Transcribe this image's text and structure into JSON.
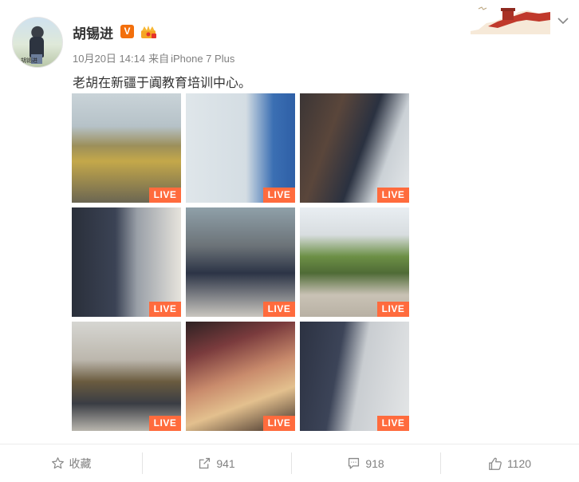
{
  "post": {
    "username": "胡锡进",
    "verified_badge": "V",
    "avatar_caption": "胡锡进",
    "date": "10月20日 14:14",
    "source_prefix": "来自",
    "source": "iPhone 7 Plus",
    "text": "老胡在新疆于阗教育培训中心。"
  },
  "images": [
    {
      "badge": "LIVE"
    },
    {
      "badge": "LIVE"
    },
    {
      "badge": "LIVE"
    },
    {
      "badge": "LIVE"
    },
    {
      "badge": "LIVE"
    },
    {
      "badge": "LIVE"
    },
    {
      "badge": "LIVE"
    },
    {
      "badge": "LIVE"
    },
    {
      "badge": "LIVE"
    }
  ],
  "actions": {
    "favorite_label": "收藏",
    "repost_count": "941",
    "comment_count": "918",
    "like_count": "1120"
  },
  "icons": {
    "favorite": "star-icon",
    "repost": "share-icon",
    "comment": "comment-icon",
    "like": "thumbs-up-icon",
    "menu": "chevron-down-icon"
  },
  "colors": {
    "live_badge": "#ff6b3d",
    "verified": "#f36f0c",
    "meta_text": "#808080"
  }
}
